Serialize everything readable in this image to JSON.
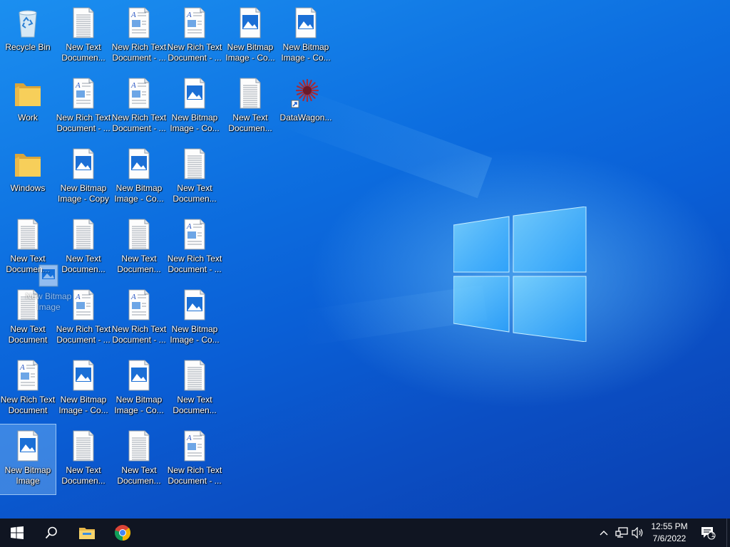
{
  "desktop": {
    "icons": [
      {
        "label": "Recycle Bin",
        "icon": "recycle-bin-icon",
        "type": "recycle"
      },
      {
        "label": "New Text\nDocumen...",
        "icon": "text-document-icon",
        "type": "text"
      },
      {
        "label": "New Rich Text\nDocument - ...",
        "icon": "rich-text-document-icon",
        "type": "rtf"
      },
      {
        "label": "New Rich Text\nDocument - ...",
        "icon": "rich-text-document-icon",
        "type": "rtf"
      },
      {
        "label": "New Bitmap\nImage - Co...",
        "icon": "bitmap-image-icon",
        "type": "bmp"
      },
      {
        "label": "New Bitmap\nImage - Co...",
        "icon": "bitmap-image-icon",
        "type": "bmp"
      },
      {
        "label": "Work",
        "icon": "folder-icon",
        "type": "folder"
      },
      {
        "label": "New Rich Text\nDocument - ...",
        "icon": "rich-text-document-icon",
        "type": "rtf"
      },
      {
        "label": "New Rich Text\nDocument - ...",
        "icon": "rich-text-document-icon",
        "type": "rtf"
      },
      {
        "label": "New Bitmap\nImage - Co...",
        "icon": "bitmap-image-icon",
        "type": "bmp"
      },
      {
        "label": "New Text\nDocumen...",
        "icon": "text-document-icon",
        "type": "text"
      },
      {
        "label": "DataWagon...",
        "icon": "datawagon-shortcut-icon",
        "type": "datawagon"
      },
      {
        "label": "Windows",
        "icon": "folder-icon",
        "type": "folder"
      },
      {
        "label": "New Bitmap\nImage - Copy",
        "icon": "bitmap-image-icon",
        "type": "bmp"
      },
      {
        "label": "New Bitmap\nImage - Co...",
        "icon": "bitmap-image-icon",
        "type": "bmp"
      },
      {
        "label": "New Text\nDocumen...",
        "icon": "text-document-icon",
        "type": "text"
      },
      {
        "label": "New Text\nDocumen...",
        "icon": "text-document-icon",
        "type": "text"
      },
      {
        "label": "New Text\nDocumen...",
        "icon": "text-document-icon",
        "type": "text"
      },
      {
        "label": "New Text\nDocumen...",
        "icon": "text-document-icon",
        "type": "text"
      },
      {
        "label": "New Rich Text\nDocument - ...",
        "icon": "rich-text-document-icon",
        "type": "rtf"
      },
      {
        "label": "New Text\nDocument",
        "icon": "text-document-icon",
        "type": "text"
      },
      {
        "label": "New Rich Text\nDocument - ...",
        "icon": "rich-text-document-icon",
        "type": "rtf"
      },
      {
        "label": "New Rich Text\nDocument - ...",
        "icon": "rich-text-document-icon",
        "type": "rtf"
      },
      {
        "label": "New Bitmap\nImage - Co...",
        "icon": "bitmap-image-icon",
        "type": "bmp"
      },
      {
        "label": "New Rich Text\nDocument",
        "icon": "rich-text-document-icon",
        "type": "rtf"
      },
      {
        "label": "New Bitmap\nImage - Co...",
        "icon": "bitmap-image-icon",
        "type": "bmp"
      },
      {
        "label": "New Bitmap\nImage - Co...",
        "icon": "bitmap-image-icon",
        "type": "bmp"
      },
      {
        "label": "New Text\nDocumen...",
        "icon": "text-document-icon",
        "type": "text"
      },
      {
        "label": "New Bitmap\nImage",
        "icon": "bitmap-image-icon",
        "type": "bmp",
        "selected": true
      },
      {
        "label": "New Text\nDocumen...",
        "icon": "text-document-icon",
        "type": "text"
      },
      {
        "label": "New Text\nDocumen...",
        "icon": "text-document-icon",
        "type": "text"
      },
      {
        "label": "New Rich Text\nDocument - ...",
        "icon": "rich-text-document-icon",
        "type": "rtf"
      }
    ],
    "drag_ghost": {
      "label": "New Bitmap\nImage",
      "icon": "bitmap-image-icon"
    }
  },
  "taskbar": {
    "start": {
      "icon": "windows-start-icon"
    },
    "search": {
      "icon": "search-icon"
    },
    "pinned": [
      {
        "name": "File Explorer",
        "icon": "file-explorer-icon"
      },
      {
        "name": "Google Chrome",
        "icon": "chrome-icon"
      }
    ],
    "tray": {
      "chevron_icon": "chevron-up-icon",
      "network_icon": "network-icon",
      "volume_icon": "volume-icon",
      "time": "12:55 PM",
      "date": "7/6/2022",
      "notification_icon": "action-center-icon",
      "notification_count": "1"
    }
  },
  "colors": {
    "taskbar": "#101522",
    "desktop_blue": "#0d6fe0",
    "selection": "#99d1ff"
  }
}
